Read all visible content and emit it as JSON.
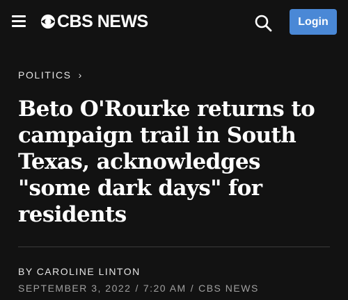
{
  "header": {
    "logo_text": "CBS NEWS",
    "login_label": "Login",
    "icons": {
      "menu": "hamburger-menu-icon",
      "logo": "cbs-eye-icon",
      "search": "search-icon"
    },
    "login_color": "#4a88d6"
  },
  "article": {
    "section": "POLITICS",
    "section_chevron": "›",
    "headline": "Beto O'Rourke returns to campaign trail in South Texas, acknowledges \"some dark days\" for residents",
    "byline_prefix": "BY",
    "author": "CAROLINE LINTON",
    "date": "SEPTEMBER 3, 2022",
    "time": "7:20 AM",
    "source": "CBS NEWS",
    "separator": "/"
  },
  "theme": {
    "background": "#121212",
    "text": "#ffffff",
    "muted_text": "#a0a0a0"
  }
}
